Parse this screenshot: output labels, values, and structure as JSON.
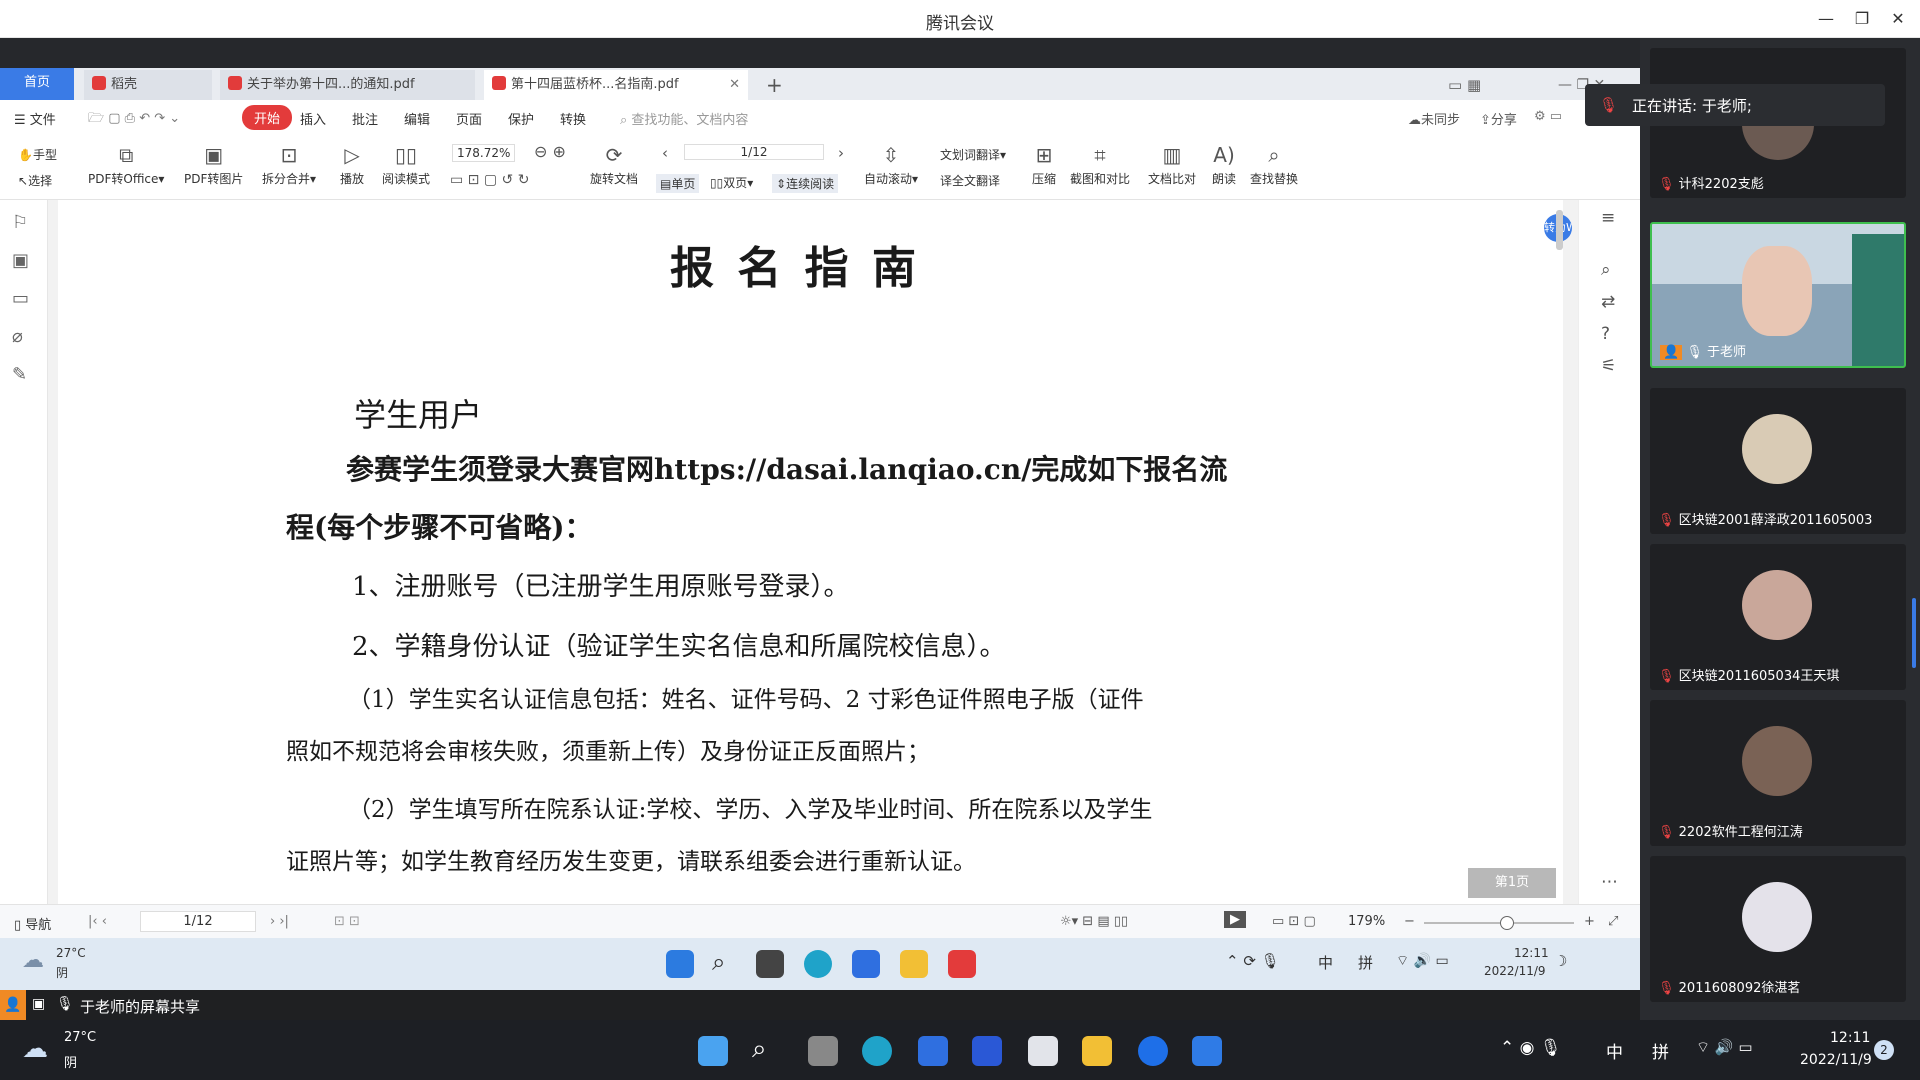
{
  "window": {
    "title": "腾讯会议"
  },
  "tabs": [
    {
      "label": "首页"
    },
    {
      "label": "稻壳"
    },
    {
      "label": "关于举办第十四...的通知.pdf"
    },
    {
      "label": "第十四届蓝桥杯...名指南.pdf"
    }
  ],
  "menu": {
    "file": "文件",
    "start": "开始",
    "items": [
      "插入",
      "批注",
      "编辑",
      "页面",
      "保护",
      "转换"
    ],
    "search_placeholder": "查找功能、文档内容",
    "unsync": "未同步",
    "share": "分享"
  },
  "toolbar": {
    "hand": "手型",
    "select": "选择",
    "pdf_to_office": "PDF转Office",
    "pdf_to_image": "PDF转图片",
    "split_merge": "拆分合并",
    "play": "播放",
    "read_mode": "阅读模式",
    "zoom": "178.72%",
    "rotate": "旋转文档",
    "page": "1/12",
    "single": "单页",
    "double": "双页",
    "continuous": "连续阅读",
    "autoscroll": "自动滚动",
    "word_translate": "划词翻译",
    "full_translate": "全文翻译",
    "compress": "压缩",
    "screenshot_compare": "截图和对比",
    "doc_compare": "文档比对",
    "read_aloud": "朗读",
    "find_replace": "查找替换"
  },
  "document": {
    "title": "报 名 指 南",
    "section": "学生用户",
    "intro1": "参赛学生须登录大赛官网https://dasai.lanqiao.cn/完成如下报名流",
    "intro2": "程(每个步骤不可省略)：",
    "step1": "1、注册账号（已注册学生用原账号登录）。",
    "step2": "2、学籍身份认证（验证学生实名信息和所属院校信息）。",
    "p1a": "（1）学生实名认证信息包括：姓名、证件号码、2 寸彩色证件照电子版（证件",
    "p1b": "照如不规范将会审核失败，须重新上传）及身份证正反面照片；",
    "p2a": "（2）学生填写所在院系认证:学校、学历、入学及毕业时间、所在院系以及学生",
    "p2b": "证照片等；如学生教育经历发生变更，请联系组委会进行重新认证。",
    "page_badge": "第1页",
    "convert_badge": "转为W"
  },
  "statusbar": {
    "nav": "导航",
    "page": "1/12",
    "zoom": "179%"
  },
  "inner_taskbar": {
    "temp": "27°C",
    "weather": "阴",
    "time": "12:11",
    "date": "2022/11/9",
    "ime_zh": "中",
    "ime_pin": "拼"
  },
  "share_bar": {
    "text": "于老师的屏幕共享"
  },
  "speaking": {
    "text": "正在讲话: 于老师;"
  },
  "participants": [
    {
      "name": "计科2202支彪"
    },
    {
      "name": "于老师"
    },
    {
      "name": "区块链2001薛泽政2011605003"
    },
    {
      "name": "区块链2011605034王天琪"
    },
    {
      "name": "2202软件工程何江涛"
    },
    {
      "name": "2011608092徐湛茗"
    }
  ],
  "host_taskbar": {
    "temp": "27°C",
    "weather": "阴",
    "time": "12:11",
    "date": "2022/11/9",
    "ime_zh": "中",
    "ime_pin": "拼",
    "badge": "2"
  },
  "colors": {
    "tab_active": "#3a7be6",
    "start_red": "#e33b3b",
    "panel_bg": "#2a2c30",
    "speaker_border": "#3fbf4f"
  }
}
